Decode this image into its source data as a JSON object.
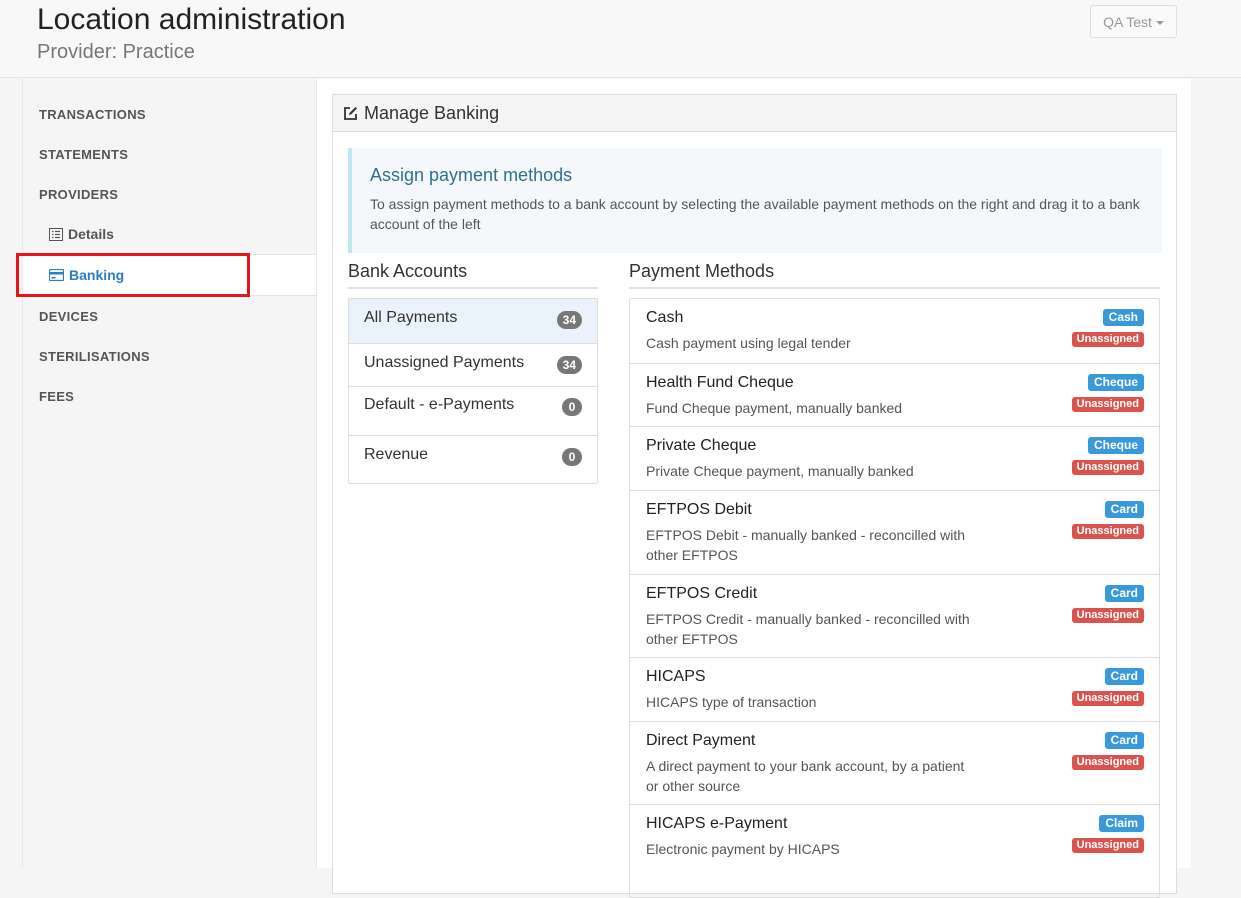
{
  "header": {
    "title": "Location administration",
    "subtitle": "Provider: Practice",
    "user_menu_label": "QA Test"
  },
  "sidebar": {
    "items": [
      {
        "label": "TRANSACTIONS"
      },
      {
        "label": "STATEMENTS"
      },
      {
        "label": "PROVIDERS"
      },
      {
        "label": "Details",
        "icon": "list-icon"
      },
      {
        "label": "Banking",
        "icon": "credit-card-icon",
        "active": true
      },
      {
        "label": "DEVICES"
      },
      {
        "label": "STERILISATIONS"
      },
      {
        "label": "FEES"
      }
    ]
  },
  "panel": {
    "title": "Manage Banking",
    "icon": "edit-icon"
  },
  "callout": {
    "title": "Assign payment methods",
    "text": "To assign payment methods to a bank account by selecting the available payment methods on the right and drag it to a bank account of the left"
  },
  "bank_accounts": {
    "title": "Bank Accounts",
    "items": [
      {
        "label": "All Payments",
        "count": "34",
        "active": true
      },
      {
        "label": "Unassigned Payments",
        "count": "34"
      },
      {
        "label": "Default - e-Payments",
        "count": "0"
      },
      {
        "label": "Revenue",
        "count": "0"
      }
    ]
  },
  "payment_methods": {
    "title": "Payment Methods",
    "items": [
      {
        "name": "Cash",
        "desc": "Cash payment using legal tender",
        "type": "Cash",
        "status": "Unassigned"
      },
      {
        "name": "Health Fund Cheque",
        "desc": "Fund Cheque payment, manually banked",
        "type": "Cheque",
        "status": "Unassigned"
      },
      {
        "name": "Private Cheque",
        "desc": "Private Cheque payment, manually banked",
        "type": "Cheque",
        "status": "Unassigned"
      },
      {
        "name": "EFTPOS Debit",
        "desc": "EFTPOS Debit - manually banked - reconcilled with other EFTPOS",
        "type": "Card",
        "status": "Unassigned"
      },
      {
        "name": "EFTPOS Credit",
        "desc": "EFTPOS Credit - manually banked - reconcilled with other EFTPOS",
        "type": "Card",
        "status": "Unassigned"
      },
      {
        "name": "HICAPS",
        "desc": "HICAPS type of transaction",
        "type": "Card",
        "status": "Unassigned"
      },
      {
        "name": "Direct Payment",
        "desc": "A direct payment to your bank account, by a patient or other source",
        "type": "Card",
        "status": "Unassigned"
      },
      {
        "name": "HICAPS e-Payment",
        "desc": "Electronic payment by HICAPS",
        "type": "Claim",
        "status": "Unassigned"
      }
    ]
  },
  "colors": {
    "accent": "#2a7fc0",
    "type_badge": "#3a9ad9",
    "status_badge": "#d9534f",
    "highlight": "#e8141b"
  }
}
